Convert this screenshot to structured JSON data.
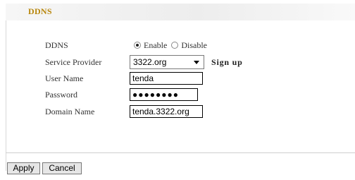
{
  "section": {
    "title": "DDNS"
  },
  "form": {
    "ddns_label": "DDNS",
    "enable_label": "Enable",
    "disable_label": "Disable",
    "ddns_selected": "Enable",
    "service_provider_label": "Service Provider",
    "service_provider_value": "3322.org",
    "signup_label": "Sign up",
    "username_label": "User Name",
    "username_value": "tenda",
    "password_label": "Password",
    "password_value": "●●●●●●●●",
    "domain_label": "Domain Name",
    "domain_value": "tenda.3322.org"
  },
  "buttons": {
    "apply": "Apply",
    "cancel": "Cancel"
  },
  "colors": {
    "title": "#b8860b",
    "titlebar_bg": "#ededed"
  },
  "icons": {
    "select_caret": "chevron-down-icon"
  }
}
